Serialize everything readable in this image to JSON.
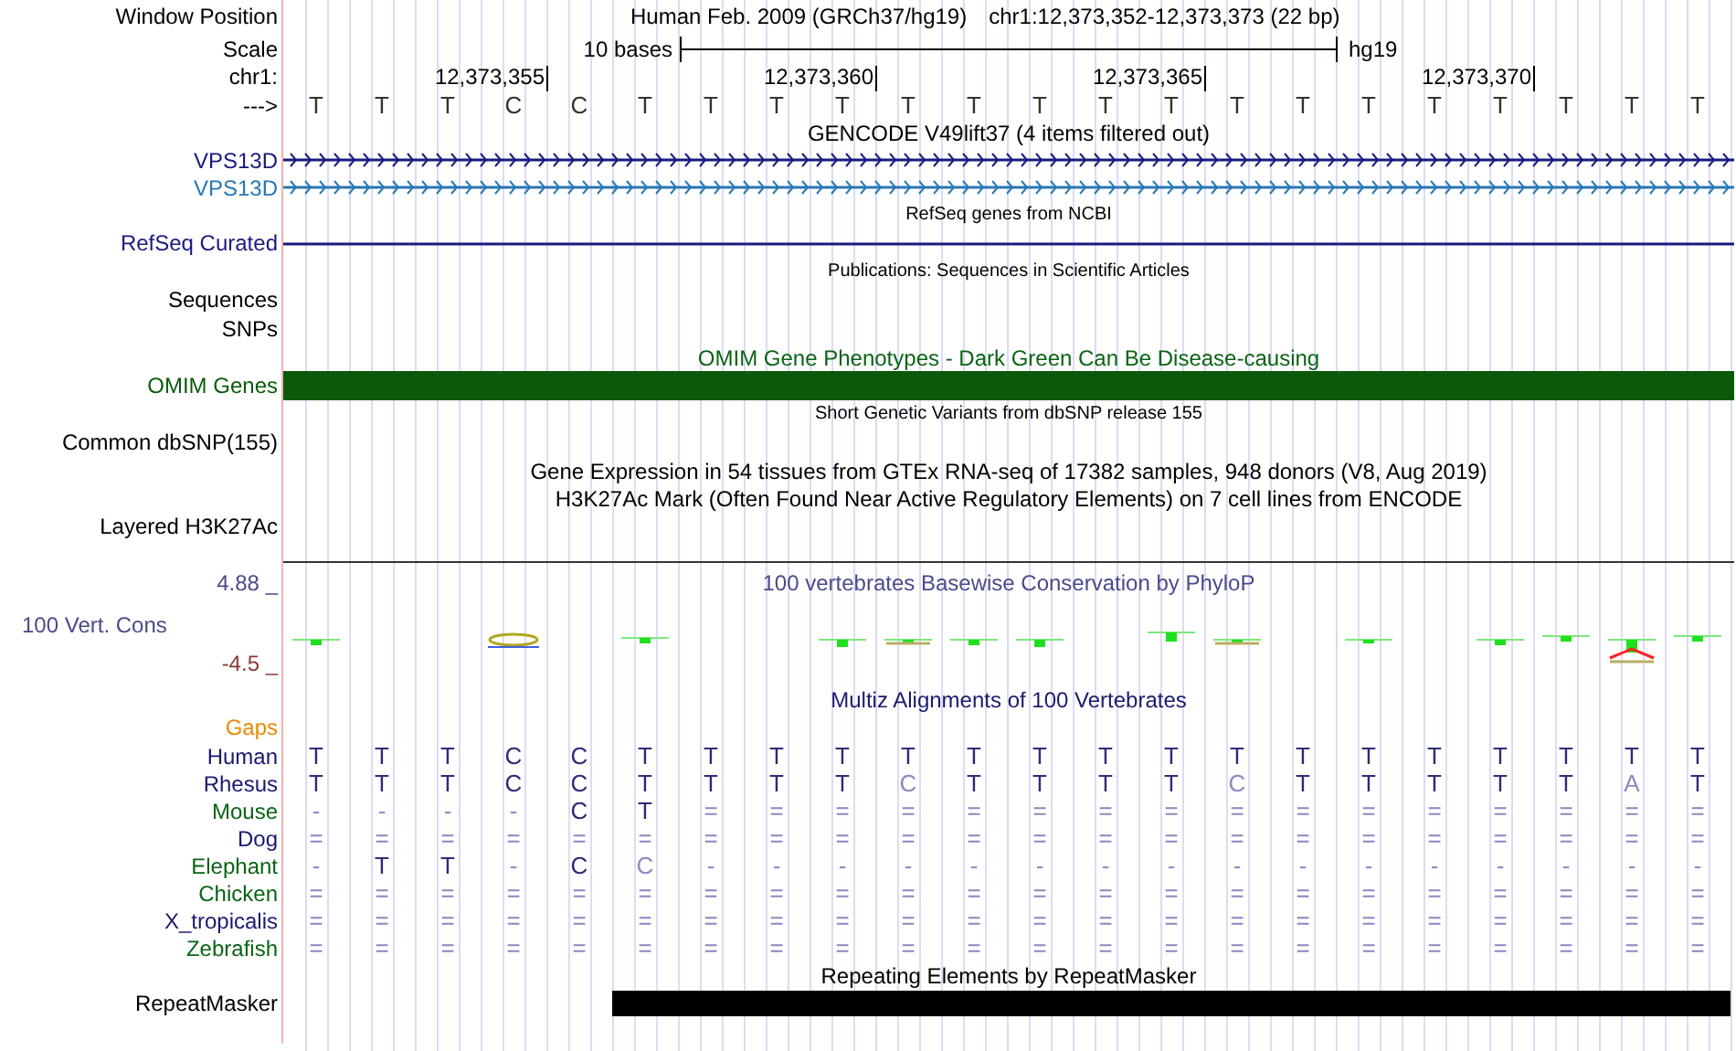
{
  "header": {
    "position_label": "Window Position",
    "scale_label": "Scale",
    "chrom_label": "chr1:",
    "strand_label": "--->",
    "assembly": "Human Feb. 2009 (GRCh37/hg19)",
    "position": "chr1:12,373,352-12,373,373 (22 bp)",
    "scale_text": "10 bases",
    "scale_db": "hg19",
    "bases": [
      {
        "base": "T"
      },
      {
        "base": "T"
      },
      {
        "base": "T"
      },
      {
        "base": "C",
        "tick": "12,373,355"
      },
      {
        "base": "C"
      },
      {
        "base": "T"
      },
      {
        "base": "T"
      },
      {
        "base": "T"
      },
      {
        "base": "T",
        "tick": "12,373,360"
      },
      {
        "base": "T"
      },
      {
        "base": "T"
      },
      {
        "base": "T"
      },
      {
        "base": "T"
      },
      {
        "base": "T",
        "tick": "12,373,365"
      },
      {
        "base": "T"
      },
      {
        "base": "T"
      },
      {
        "base": "T"
      },
      {
        "base": "T"
      },
      {
        "base": "T",
        "tick": "12,373,370"
      },
      {
        "base": "T"
      },
      {
        "base": "T"
      },
      {
        "base": "T"
      }
    ]
  },
  "tracks": [
    {
      "kind": "title",
      "text": "GENCODE V49lift37 (4 items filtered out)",
      "color": "#000000"
    },
    {
      "kind": "gene",
      "label": "VPS13D",
      "color": "#1a1a80"
    },
    {
      "kind": "gene",
      "label": "VPS13D",
      "color": "#2878b4"
    },
    {
      "kind": "subtitle",
      "text": "RefSeq genes from NCBI"
    },
    {
      "kind": "line",
      "label": "RefSeq Curated",
      "color": "#1a1a80"
    },
    {
      "kind": "subtitle",
      "text": "Publications: Sequences in Scientific Articles"
    },
    {
      "kind": "label",
      "label": "Sequences",
      "color": "#000000"
    },
    {
      "kind": "label",
      "label": "SNPs",
      "color": "#000000"
    },
    {
      "kind": "title",
      "text": "OMIM Gene Phenotypes - Dark Green Can Be Disease-causing",
      "color": "#0a6414"
    },
    {
      "kind": "bar",
      "label": "OMIM Genes",
      "color": "#0a5a0a"
    },
    {
      "kind": "subtitle",
      "text": "Short Genetic Variants from dbSNP release 155"
    },
    {
      "kind": "label",
      "label": "Common dbSNP(155)",
      "color": "#000000"
    },
    {
      "kind": "title",
      "text": "Gene Expression in 54 tissues from GTEx RNA-seq of 17382 samples, 948 donors (V8, Aug 2019)",
      "color": "#000000"
    },
    {
      "kind": "title",
      "text": "H3K27Ac Mark (Often Found Near Active Regulatory Elements) on 7 cell lines from ENCODE",
      "color": "#000000"
    },
    {
      "kind": "plot",
      "label": "Layered H3K27Ac"
    },
    {
      "kind": "conservation",
      "title": "100 vertebrates Basewise Conservation by PhyloP",
      "label": "100 Vert. Cons",
      "max": "4.88 _",
      "min": "-4.5 _"
    },
    {
      "kind": "title",
      "text": "Multiz Alignments of 100 Vertebrates",
      "color": "#1a1a70"
    },
    {
      "kind": "label",
      "label": "Gaps",
      "color": "#e88a00"
    },
    {
      "kind": "alignment",
      "species": [
        {
          "name": "Human",
          "color": "#191970",
          "bases": [
            "T",
            "T",
            "T",
            "C",
            "C",
            "T",
            "T",
            "T",
            "T",
            "T",
            "T",
            "T",
            "T",
            "T",
            "T",
            "T",
            "T",
            "T",
            "T",
            "T",
            "T",
            "T"
          ],
          "faded": [
            false,
            false,
            false,
            false,
            false,
            false,
            false,
            false,
            false,
            false,
            false,
            false,
            false,
            false,
            false,
            false,
            false,
            false,
            false,
            false,
            false,
            false
          ]
        },
        {
          "name": "Rhesus",
          "color": "#191970",
          "bases": [
            "T",
            "T",
            "T",
            "C",
            "C",
            "T",
            "T",
            "T",
            "T",
            "C",
            "T",
            "T",
            "T",
            "T",
            "C",
            "T",
            "T",
            "T",
            "T",
            "T",
            "A",
            "T"
          ],
          "faded": [
            false,
            false,
            false,
            false,
            false,
            false,
            false,
            false,
            false,
            true,
            false,
            false,
            false,
            false,
            true,
            false,
            false,
            false,
            false,
            false,
            true,
            false
          ]
        },
        {
          "name": "Mouse",
          "color": "#0a6414",
          "bases": [
            "-",
            "-",
            "-",
            "-",
            "C",
            "T",
            "=",
            "=",
            "=",
            "=",
            "=",
            "=",
            "=",
            "=",
            "=",
            "=",
            "=",
            "=",
            "=",
            "=",
            "=",
            "="
          ],
          "faded": [
            true,
            true,
            true,
            true,
            false,
            false,
            true,
            true,
            true,
            true,
            true,
            true,
            true,
            true,
            true,
            true,
            true,
            true,
            true,
            true,
            true,
            true
          ]
        },
        {
          "name": "Dog",
          "color": "#191970",
          "bases": [
            "=",
            "=",
            "=",
            "=",
            "=",
            "=",
            "=",
            "=",
            "=",
            "=",
            "=",
            "=",
            "=",
            "=",
            "=",
            "=",
            "=",
            "=",
            "=",
            "=",
            "=",
            "="
          ],
          "faded": [
            true,
            true,
            true,
            true,
            true,
            true,
            true,
            true,
            true,
            true,
            true,
            true,
            true,
            true,
            true,
            true,
            true,
            true,
            true,
            true,
            true,
            true
          ]
        },
        {
          "name": "Elephant",
          "color": "#0a6414",
          "bases": [
            "-",
            "T",
            "T",
            "-",
            "C",
            "C",
            "-",
            "-",
            "-",
            "-",
            "-",
            "-",
            "-",
            "-",
            "-",
            "-",
            "-",
            "-",
            "-",
            "-",
            "-",
            "-"
          ],
          "faded": [
            true,
            false,
            false,
            true,
            false,
            true,
            true,
            true,
            true,
            true,
            true,
            true,
            true,
            true,
            true,
            true,
            true,
            true,
            true,
            true,
            true,
            true
          ]
        },
        {
          "name": "Chicken",
          "color": "#0a6414",
          "bases": [
            "=",
            "=",
            "=",
            "=",
            "=",
            "=",
            "=",
            "=",
            "=",
            "=",
            "=",
            "=",
            "=",
            "=",
            "=",
            "=",
            "=",
            "=",
            "=",
            "=",
            "=",
            "="
          ],
          "faded": [
            true,
            true,
            true,
            true,
            true,
            true,
            true,
            true,
            true,
            true,
            true,
            true,
            true,
            true,
            true,
            true,
            true,
            true,
            true,
            true,
            true,
            true
          ]
        },
        {
          "name": "X_tropicalis",
          "color": "#191970",
          "bases": [
            "=",
            "=",
            "=",
            "=",
            "=",
            "=",
            "=",
            "=",
            "=",
            "=",
            "=",
            "=",
            "=",
            "=",
            "=",
            "=",
            "=",
            "=",
            "=",
            "=",
            "=",
            "="
          ],
          "faded": [
            true,
            true,
            true,
            true,
            true,
            true,
            true,
            true,
            true,
            true,
            true,
            true,
            true,
            true,
            true,
            true,
            true,
            true,
            true,
            true,
            true,
            true
          ]
        },
        {
          "name": "Zebrafish",
          "color": "#0a6414",
          "bases": [
            "=",
            "=",
            "=",
            "=",
            "=",
            "=",
            "=",
            "=",
            "=",
            "=",
            "=",
            "=",
            "=",
            "=",
            "=",
            "=",
            "=",
            "=",
            "=",
            "=",
            "=",
            "="
          ],
          "faded": [
            true,
            true,
            true,
            true,
            true,
            true,
            true,
            true,
            true,
            true,
            true,
            true,
            true,
            true,
            true,
            true,
            true,
            true,
            true,
            true,
            true,
            true
          ]
        }
      ]
    },
    {
      "kind": "title",
      "text": "Repeating Elements by RepeatMasker",
      "color": "#000000"
    },
    {
      "kind": "repeat",
      "label": "RepeatMasker",
      "covered": [
        false,
        false,
        false,
        false,
        false,
        true,
        true,
        true,
        true,
        true,
        true,
        true,
        true,
        true,
        true,
        true,
        true,
        true,
        true,
        true,
        true,
        true
      ]
    }
  ]
}
